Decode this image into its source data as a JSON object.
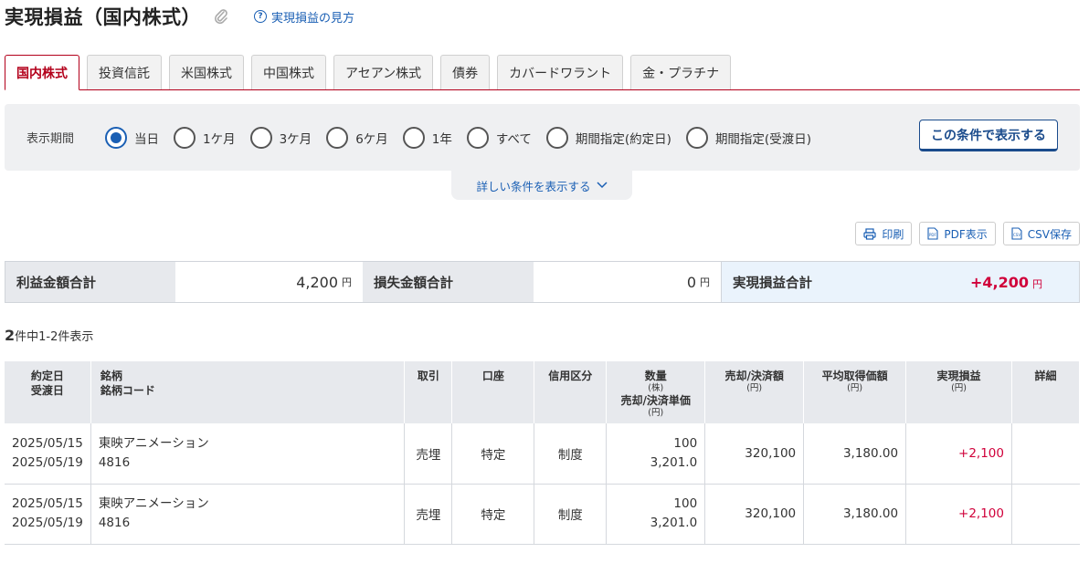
{
  "header": {
    "title": "実現損益（国内株式）",
    "help_link": "実現損益の見方"
  },
  "tabs": [
    {
      "label": "国内株式",
      "active": true
    },
    {
      "label": "投資信託"
    },
    {
      "label": "米国株式"
    },
    {
      "label": "中国株式"
    },
    {
      "label": "アセアン株式"
    },
    {
      "label": "債券"
    },
    {
      "label": "カバードワラント"
    },
    {
      "label": "金・プラチナ"
    }
  ],
  "filter": {
    "label": "表示期間",
    "options": [
      "当日",
      "1ケ月",
      "3ケ月",
      "6ケ月",
      "1年",
      "すべて",
      "期間指定(約定日)",
      "期間指定(受渡日)"
    ],
    "selected": "当日",
    "apply_button": "この条件で表示する",
    "more_conditions": "詳しい条件を表示する"
  },
  "actions": {
    "print": "印刷",
    "pdf": "PDF表示",
    "csv": "CSV保存"
  },
  "summary": {
    "profit_label": "利益金額合計",
    "profit_value": "4,200",
    "loss_label": "損失金額合計",
    "loss_value": "0",
    "total_label": "実現損益合計",
    "total_value": "+4,200",
    "unit": "円"
  },
  "count": {
    "total": "2",
    "text": "件中1-2件表示"
  },
  "table": {
    "headers": {
      "date1": "約定日",
      "date2": "受渡日",
      "name1": "銘柄",
      "name2": "銘柄コード",
      "trade": "取引",
      "account": "口座",
      "margin": "信用区分",
      "qty": "数量",
      "qty_unit": "(株)",
      "price": "売却/決済単価",
      "price_unit": "(円)",
      "amount": "売却/決済額",
      "amount_unit": "(円)",
      "avg": "平均取得価額",
      "avg_unit": "(円)",
      "pl": "実現損益",
      "pl_unit": "(円)",
      "detail": "詳細"
    },
    "rows": [
      {
        "trade_date": "2025/05/15",
        "settle_date": "2025/05/19",
        "name": "東映アニメーション",
        "code": "4816",
        "trade": "売埋",
        "account": "特定",
        "margin": "制度",
        "qty": "100",
        "price": "3,201.0",
        "amount": "320,100",
        "avg": "3,180.00",
        "pl": "+2,100"
      },
      {
        "trade_date": "2025/05/15",
        "settle_date": "2025/05/19",
        "name": "東映アニメーション",
        "code": "4816",
        "trade": "売埋",
        "account": "特定",
        "margin": "制度",
        "qty": "100",
        "price": "3,201.0",
        "amount": "320,100",
        "avg": "3,180.00",
        "pl": "+2,100"
      }
    ]
  }
}
